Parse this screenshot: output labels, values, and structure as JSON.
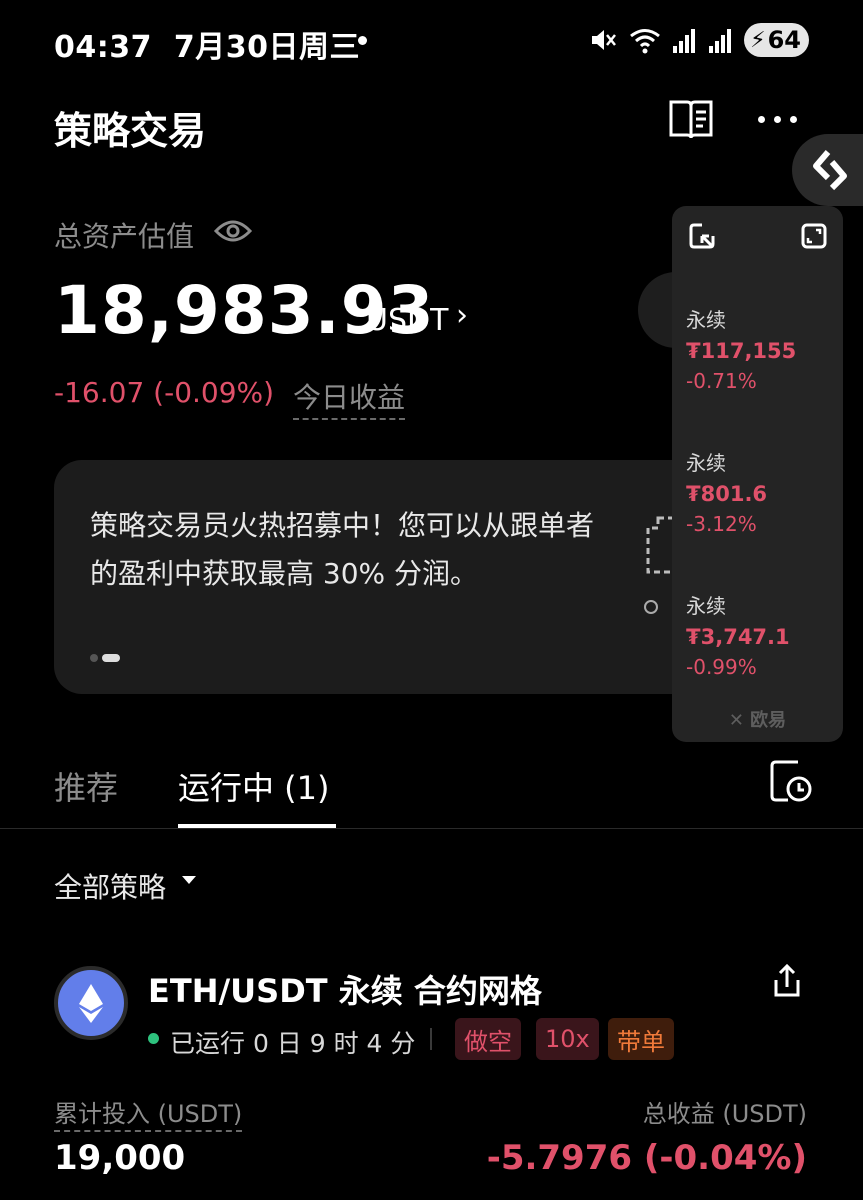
{
  "status_bar": {
    "time": "04:37",
    "date": "7月30日周三",
    "battery": "64",
    "icons": [
      "mute-icon",
      "wifi-icon",
      "signal-icon",
      "signal-icon",
      "battery-icon"
    ]
  },
  "header": {
    "title": "策略交易"
  },
  "assets": {
    "label": "总资产估值",
    "value": "18,983.93",
    "unit": "USDT",
    "arrow": "›",
    "today_pnl": "-16.07 (-0.09%)",
    "today_pnl_label": "今日收益"
  },
  "banner": {
    "text": "策略交易员火热招募中！您可以从跟单者的盈利中获取最高 30% 分润。"
  },
  "ticker": {
    "items": [
      {
        "name": "永续",
        "price": "₮117,155",
        "change": "-0.71%"
      },
      {
        "name": "永续",
        "price": "₮801.6",
        "change": "-3.12%"
      },
      {
        "name": "永续",
        "price": "₮3,747.1",
        "change": "-0.99%"
      }
    ],
    "brand": "欧易"
  },
  "tabs": {
    "recommended": "推荐",
    "running": "运行中 (1)"
  },
  "filter": {
    "label": "全部策略"
  },
  "strategy": {
    "title": "ETH/USDT 永续 合约网格",
    "run_time": "已运行 0 日 9 时 4 分",
    "tags": [
      "做空",
      "10x",
      "带单"
    ],
    "invest_label": "累计投入 (USDT)",
    "invest_value": "19,000",
    "profit_label": "总收益 (USDT)",
    "profit_value": "-5.7976 (-0.04%)"
  },
  "colors": {
    "background": "#000000",
    "negative": "#e0516a",
    "running": "#2ec27e",
    "copy_tag": "#f07a3a",
    "eth": "#627eea"
  }
}
